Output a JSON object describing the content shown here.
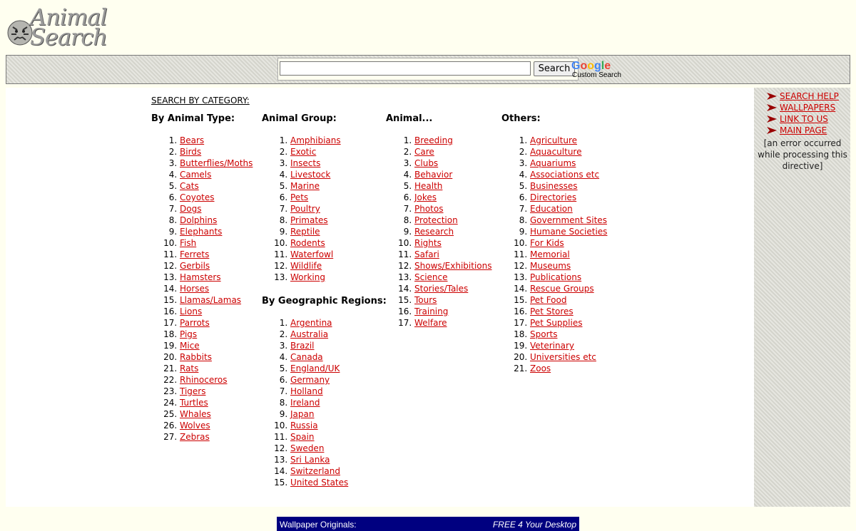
{
  "logo": {
    "line1": "Animal",
    "line2": "Search"
  },
  "search": {
    "button_label": "Search",
    "input_value": "",
    "google_sub": "Custom Search"
  },
  "category_heading": "SEARCH BY CATEGORY:",
  "columns": {
    "animal_type": {
      "title": "By Animal Type:",
      "items": [
        "Bears",
        "Birds",
        "Butterflies/Moths",
        "Camels",
        "Cats",
        "Coyotes",
        "Dogs",
        "Dolphins",
        "Elephants",
        "Fish",
        "Ferrets",
        "Gerbils",
        "Hamsters",
        "Horses",
        "Llamas/Lamas",
        "Lions",
        "Parrots",
        "Pigs",
        "Mice",
        "Rabbits",
        "Rats",
        "Rhinoceros",
        "Tigers",
        "Turtles",
        "Whales",
        "Wolves",
        "Zebras"
      ]
    },
    "animal_group": {
      "title": "Animal Group:",
      "items": [
        "Amphibians",
        "Exotic",
        "Insects",
        "Livestock",
        "Marine",
        "Pets",
        "Poultry",
        "Primates",
        "Reptile",
        "Rodents",
        "Waterfowl",
        "Wildlife",
        "Working"
      ]
    },
    "geographic": {
      "title": "By Geographic Regions:",
      "items": [
        "Argentina",
        "Australia",
        "Brazil",
        "Canada",
        "England/UK",
        "Germany",
        "Holland",
        "Ireland",
        "Japan",
        "Russia",
        "Spain",
        "Sweden",
        "Sri Lanka",
        "Switzerland",
        "United States"
      ]
    },
    "animal": {
      "title": "Animal...",
      "items": [
        "Breeding",
        "Care",
        "Clubs",
        "Behavior",
        "Health",
        "Jokes",
        "Photos",
        "Protection",
        "Research",
        "Rights",
        "Safari",
        "Shows/Exhibitions",
        "Science",
        "Stories/Tales",
        "Tours",
        "Training",
        "Welfare"
      ]
    },
    "others": {
      "title": "Others:",
      "items": [
        "Agriculture",
        "Aquaculture",
        "Aquariums",
        "Associations etc",
        "Businesses",
        "Directories",
        "Education",
        "Government Sites",
        "Humane Societies",
        "For Kids",
        "Memorial",
        "Museums",
        "Publications",
        "Rescue Groups",
        "Pet Food",
        "Pet Stores",
        "Pet Supplies",
        "Sports",
        "Veterinary",
        "Universities etc",
        "Zoos"
      ]
    }
  },
  "sidebar": {
    "links": [
      "SEARCH HELP",
      "WALLPAPERS",
      "LINK TO US",
      "MAIN PAGE"
    ],
    "error": "[an error occurred while processing this directive]"
  },
  "banner": {
    "left": "Wallpaper Originals:",
    "right": "FREE 4 Your Desktop"
  },
  "colors": {
    "link": "#cc0000",
    "background": "#fffff0",
    "banner": "#000080"
  }
}
